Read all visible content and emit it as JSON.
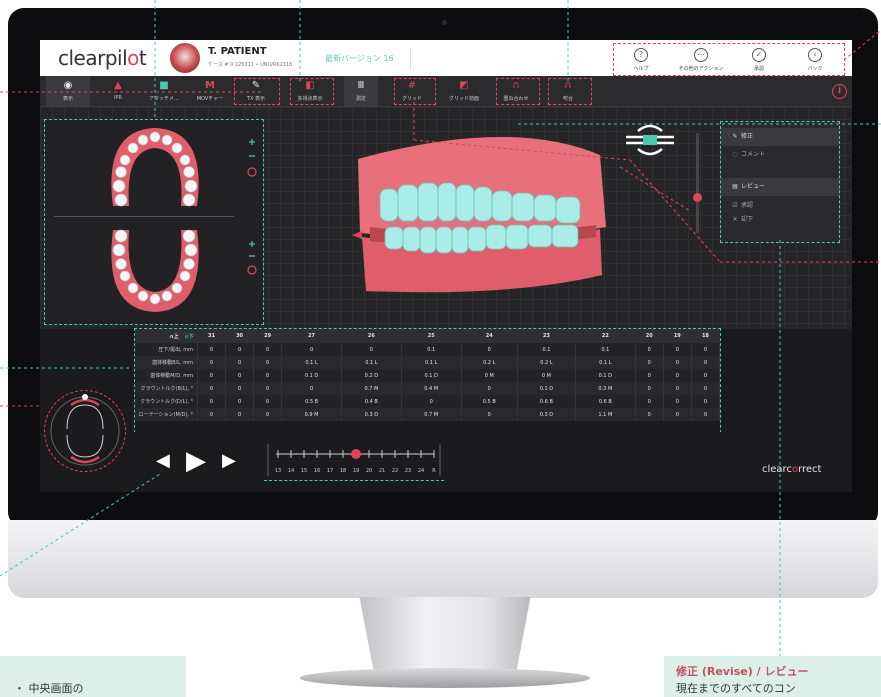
{
  "header": {
    "logo": "clearpil",
    "logo_accent": "o",
    "logo_end": "t",
    "patient_name": "T. PATIENT",
    "patient_case": "ケース # 0 225211 • UNU/R62318",
    "version": "最新バージョン 16",
    "buttons": [
      {
        "icon": "help-icon",
        "glyph": "?",
        "label": "ヘルプ"
      },
      {
        "icon": "more-options-icon",
        "glyph": "⋯",
        "label": "その他のアクション"
      },
      {
        "icon": "approve-check-icon",
        "glyph": "✓",
        "label": "承認"
      },
      {
        "icon": "back-arrow-icon",
        "glyph": "‹",
        "label": "バック"
      }
    ]
  },
  "toolbar": {
    "items": [
      {
        "icon": "eye-icon",
        "glyph": "◉",
        "label": "表示",
        "color": "#e6e6e6"
      },
      {
        "icon": "ipr-icon",
        "glyph": "▲",
        "label": "IPR",
        "color": "#e0445a"
      },
      {
        "icon": "attachment-icon",
        "glyph": "■",
        "label": "アタッチメ…",
        "color": "#4cc9b0"
      },
      {
        "icon": "movement-chart-icon",
        "glyph": "M",
        "label": "MOVチャー",
        "color": "#e0445a"
      },
      {
        "icon": "ipr-display-icon",
        "glyph": "✎",
        "label": "TX 表示",
        "color": "#e6e6e6"
      },
      {
        "icon": "multi-view-icon",
        "glyph": "◧",
        "label": "多視点表示",
        "color": "#e0445a"
      },
      {
        "icon": "measure-icon",
        "glyph": "Ⅲ",
        "label": "測定",
        "color": "#e6e6e6"
      },
      {
        "icon": "grid-icon",
        "glyph": "#",
        "label": "グリッド",
        "color": "#e0445a"
      },
      {
        "icon": "grid-front-icon",
        "glyph": "◩",
        "label": "グリッド前面",
        "color": "#e0445a"
      },
      {
        "icon": "bite-icon",
        "glyph": "∩",
        "label": "重ね合わせ",
        "color": "#e0445a"
      },
      {
        "icon": "occlusion-icon",
        "glyph": "∩",
        "label": "咬合",
        "color": "#e0445a"
      }
    ]
  },
  "side_panel": {
    "revise": "修正",
    "comment": "コメント",
    "review": "レビュー",
    "approve": "承認",
    "reject": "却下"
  },
  "table": {
    "header_upper": "∩上",
    "header_lower": "∪下",
    "teeth": [
      "31",
      "30",
      "29",
      "27",
      "26",
      "25",
      "24",
      "23",
      "22",
      "20",
      "19",
      "18"
    ],
    "rows": [
      {
        "label": "圧下/挺出, mm",
        "values": [
          "0",
          "0",
          "0",
          "0",
          "0",
          "0.1",
          "0",
          "0.1",
          "0.1",
          "0",
          "0",
          "0"
        ]
      },
      {
        "label": "歯体移動B/L, mm",
        "values": [
          "0",
          "0",
          "0",
          "0.1 L",
          "0.1 L",
          "0.1 L",
          "0.2 L",
          "0.2 L",
          "0.1 L",
          "0",
          "0",
          "0"
        ]
      },
      {
        "label": "歯体移動M/D, mm",
        "values": [
          "0",
          "0",
          "0",
          "0.1 D",
          "0.2 D",
          "0.1 D",
          "0 M",
          "0 M",
          "0.1 D",
          "0",
          "0",
          "0"
        ]
      },
      {
        "label": "クラウントルク(B/L), °",
        "values": [
          "0",
          "0",
          "0",
          "0",
          "0.7 M",
          "0.4 M",
          "0",
          "0.1 D",
          "0.3 M",
          "0",
          "0",
          "0"
        ]
      },
      {
        "label": "クラウントルク(D/L), °",
        "values": [
          "0",
          "0",
          "0",
          "0.5 B",
          "0.4 B",
          "0",
          "0.5 B",
          "0.6 B",
          "0.6 B",
          "0",
          "0",
          "0"
        ]
      },
      {
        "label": "ローテーション(M/D), °",
        "values": [
          "0",
          "0",
          "0",
          "0.9 M",
          "0.3 D",
          "0.7 M",
          "0",
          "0.3 D",
          "1.1 M",
          "0",
          "0",
          "0"
        ]
      }
    ]
  },
  "timeline": {
    "stages": [
      "13",
      "14",
      "15",
      "16",
      "17",
      "18",
      "19",
      "20",
      "21",
      "22",
      "23",
      "24",
      "R"
    ],
    "current_stage": "19"
  },
  "brand_footer": {
    "left": "clearc",
    "accent": "o",
    "right": "rrect"
  },
  "callouts": {
    "left_text": "・ 中央画面の",
    "right_title": "修正 (Revise) / レビュー",
    "right_text": "現在までのすべてのコン"
  },
  "colors": {
    "accent": "#e0445a",
    "teal": "#4cc9b0"
  }
}
